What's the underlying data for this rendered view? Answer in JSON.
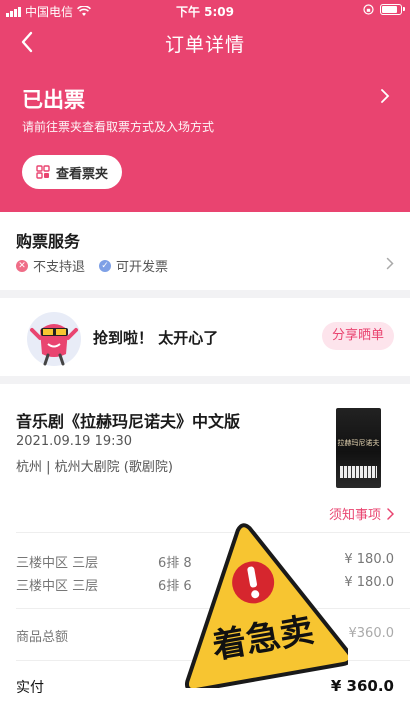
{
  "statusbar": {
    "carrier": "中国电信",
    "time": "下午 5:09"
  },
  "nav": {
    "title": "订单详情"
  },
  "order_status": {
    "title": "已出票",
    "subtitle": "请前往票夹查看取票方式及入场方式",
    "ticket_button_label": "查看票夹"
  },
  "service": {
    "title": "购票服务",
    "items": [
      {
        "label": "不支持退",
        "color": "#ef6d87"
      },
      {
        "label": "可开发票",
        "color": "#7ea0e6"
      }
    ]
  },
  "share": {
    "text": "抢到啦！ 太开心了",
    "button_label": "分享晒单"
  },
  "show": {
    "name": "音乐剧《拉赫玛尼诺夫》中文版",
    "datetime": "2021.09.19 19:30",
    "venue": "杭州 | 杭州大剧院 (歌剧院)",
    "poster_title": "拉赫玛尼诺夫",
    "notice_label": "须知事项"
  },
  "tickets": [
    {
      "area": "三楼中区 三层",
      "seat": "6排 8",
      "price": "¥ 180.0"
    },
    {
      "area": "三楼中区 三层",
      "seat": "6排 6",
      "price": "¥ 180.0"
    }
  ],
  "totals": {
    "total_label": "商品总额",
    "total_value": "¥360.0",
    "paid_label": "实付",
    "paid_value": "¥ 360.0"
  },
  "sticker": {
    "text": "着急卖"
  },
  "colors": {
    "accent": "#e94470",
    "sticker_yellow": "#f7c531"
  }
}
